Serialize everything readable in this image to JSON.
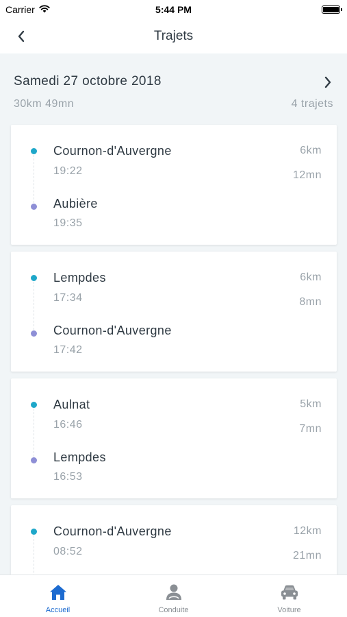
{
  "status_bar": {
    "carrier": "Carrier",
    "time": "5:44 PM"
  },
  "nav": {
    "title": "Trajets"
  },
  "day": {
    "date": "Samedi 27 octobre 2018",
    "summary": "30km 49mn",
    "count": "4 trajets"
  },
  "trips": [
    {
      "start_place": "Cournon-d'Auvergne",
      "start_time": "19:22",
      "end_place": "Aubière",
      "end_time": "19:35",
      "distance": "6km",
      "duration": "12mn"
    },
    {
      "start_place": "Lempdes",
      "start_time": "17:34",
      "end_place": "Cournon-d'Auvergne",
      "end_time": "17:42",
      "distance": "6km",
      "duration": "8mn"
    },
    {
      "start_place": "Aulnat",
      "start_time": "16:46",
      "end_place": "Lempdes",
      "end_time": "16:53",
      "distance": "5km",
      "duration": "7mn"
    },
    {
      "start_place": "Cournon-d'Auvergne",
      "start_time": "08:52",
      "end_place": "",
      "end_time": "",
      "distance": "12km",
      "duration": "21mn"
    }
  ],
  "tabs": [
    {
      "label": "Accueil",
      "icon": "home-icon",
      "active": true
    },
    {
      "label": "Conduite",
      "icon": "driver-icon",
      "active": false
    },
    {
      "label": "Voiture",
      "icon": "car-icon",
      "active": false
    }
  ],
  "colors": {
    "accent": "#1d6bd0",
    "start_dot": "#1ea7c9",
    "end_dot": "#8e8fd6",
    "background": "#f1f5f7"
  }
}
